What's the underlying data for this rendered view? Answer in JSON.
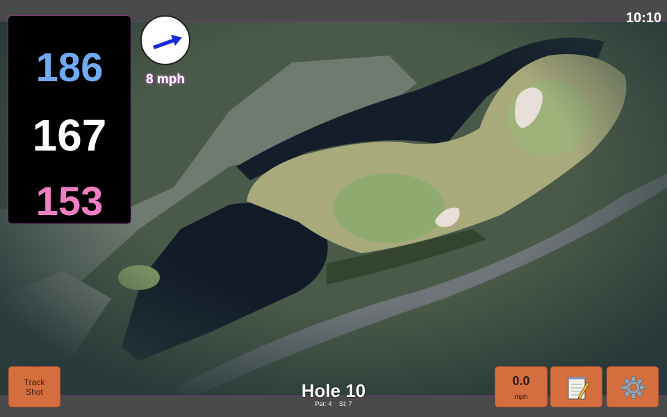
{
  "status": {
    "time": "10:10"
  },
  "distances": {
    "back": "186",
    "middle": "167",
    "front": "153"
  },
  "wind": {
    "speed": "8 mph",
    "icon": "wind-arrow-icon"
  },
  "buttons": {
    "track_shot": "Track\nShot",
    "speed_value": "0.0",
    "speed_unit": "mph",
    "notes_icon": "notepad-icon",
    "settings_icon": "gear-icon"
  },
  "hole": {
    "title": "Hole 10",
    "par": "Par: 4",
    "si": "SI: 7"
  },
  "colors": {
    "back_distance": "#70aaf2",
    "middle_distance": "#ffffff",
    "front_distance": "#f07fc2",
    "button": "#d56e3f",
    "accent_border": "#7a3a80",
    "water": "#121e2c",
    "fairway": "#a8a878",
    "bunker": "#e8e0d8"
  }
}
